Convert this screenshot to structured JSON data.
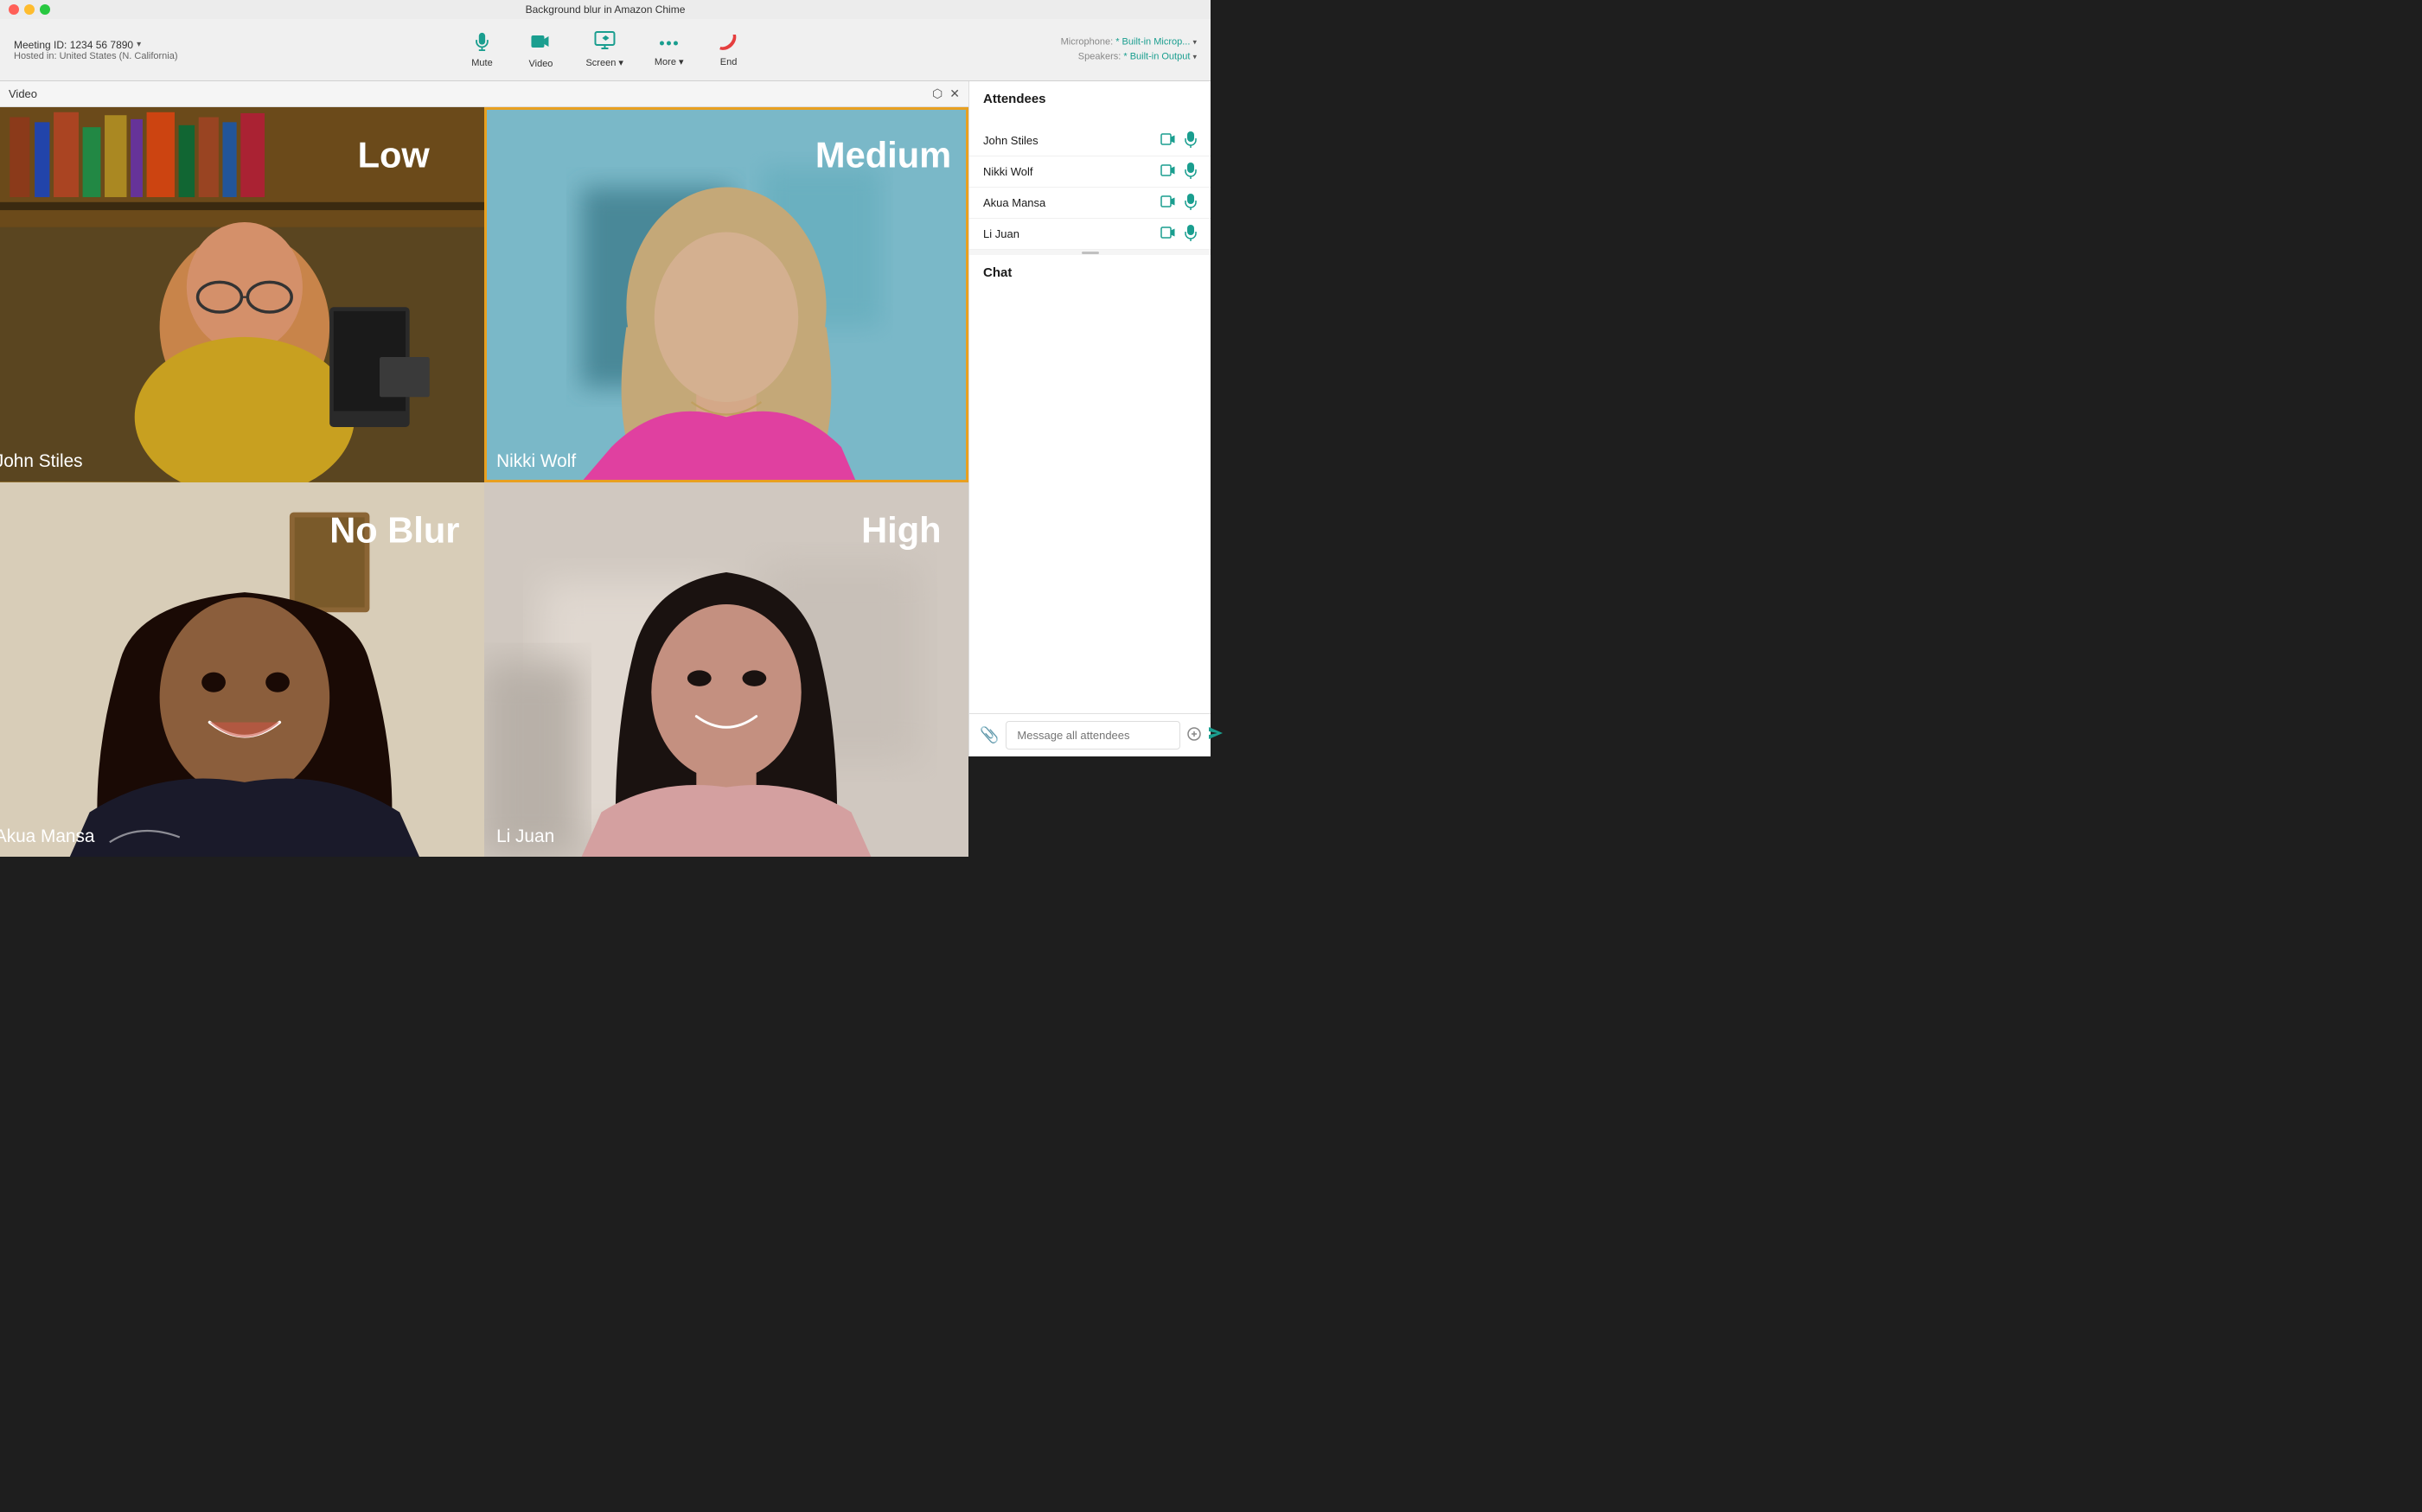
{
  "titleBar": {
    "title": "Background blur in Amazon Chime"
  },
  "toolbar": {
    "meetingId": "Meeting ID: 1234 56 7890",
    "hostedIn": "Hosted in: United States (N. California)",
    "buttons": [
      {
        "id": "mute",
        "label": "Mute",
        "icon": "🎙"
      },
      {
        "id": "video",
        "label": "Video",
        "icon": "📷"
      },
      {
        "id": "screen",
        "label": "Screen",
        "icon": "🖥",
        "hasDropdown": true
      },
      {
        "id": "more",
        "label": "More",
        "icon": "•••",
        "hasDropdown": true
      },
      {
        "id": "end",
        "label": "End",
        "icon": "📵"
      }
    ],
    "microphone": {
      "label": "Microphone:",
      "value": "* Built-in Microp...",
      "hasDropdown": true
    },
    "speakers": {
      "label": "Speakers:",
      "value": "* Built-in Output",
      "hasDropdown": true
    }
  },
  "videoPanel": {
    "title": "Video",
    "participants": [
      {
        "id": "john-stiles",
        "name": "John Stiles",
        "blurLabel": "Low",
        "active": false
      },
      {
        "id": "nikki-wolf",
        "name": "Nikki Wolf",
        "blurLabel": "Medium",
        "active": true
      },
      {
        "id": "akua-mansa",
        "name": "Akua Mansa",
        "blurLabel": "No Blur",
        "active": false
      },
      {
        "id": "li-juan",
        "name": "Li Juan",
        "blurLabel": "High",
        "active": false
      }
    ]
  },
  "sidebar": {
    "attendeesTitle": "Attendees",
    "attendees": [
      {
        "id": "john-stiles",
        "name": "John Stiles"
      },
      {
        "id": "nikki-wolf",
        "name": "Nikki Wolf"
      },
      {
        "id": "akua-mansa",
        "name": "Akua Mansa"
      },
      {
        "id": "li-juan",
        "name": "Li Juan"
      }
    ],
    "chatTitle": "Chat",
    "chatPlaceholder": "Message all attendees"
  }
}
